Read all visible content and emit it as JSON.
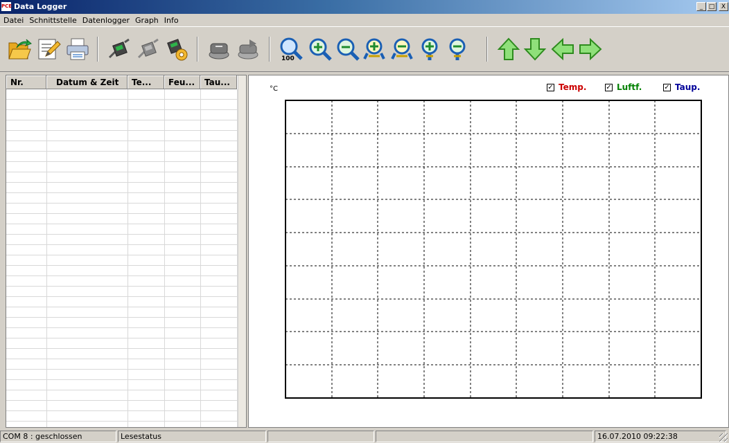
{
  "window": {
    "title": "Data Logger",
    "app_icon_text": "PCE"
  },
  "window_buttons": {
    "minimize": "_",
    "maximize": "□",
    "close": "X"
  },
  "menu": [
    "Datei",
    "Schnittstelle",
    "Datenlogger",
    "Graph",
    "Info"
  ],
  "toolbar": {
    "icons": [
      "open-file-icon",
      "edit-document-icon",
      "printer-icon",
      "connect-device-icon",
      "disconnect-device-icon",
      "device-settings-icon",
      "read-data-icon",
      "write-data-icon",
      "zoom-100-icon",
      "zoom-in-icon",
      "zoom-out-icon",
      "zoom-x-in-icon",
      "zoom-x-out-icon",
      "zoom-y-in-icon",
      "zoom-y-out-icon",
      "arrow-up-icon",
      "arrow-down-icon",
      "arrow-left-icon",
      "arrow-right-icon"
    ],
    "zoom_label": "100"
  },
  "table": {
    "columns": [
      "Nr.",
      "Datum & Zeit",
      "Te...",
      "Feu...",
      "Tau..."
    ],
    "rows": []
  },
  "chart_data": {
    "type": "line",
    "title": "",
    "ylabel": "°C",
    "xlabel": "",
    "series": [
      {
        "name": "Temp.",
        "values": [],
        "color": "#cc0000",
        "checked": true
      },
      {
        "name": "Luftf.",
        "values": [],
        "color": "#008000",
        "checked": true
      },
      {
        "name": "Taup.",
        "values": [],
        "color": "#000099",
        "checked": true
      }
    ],
    "grid": true,
    "legend": "top-right"
  },
  "statusbar": {
    "port": "COM 8 : geschlossen",
    "read_status": "Lesestatus",
    "panel3": "",
    "panel4": "",
    "datetime": "16.07.2010 09:22:38"
  }
}
